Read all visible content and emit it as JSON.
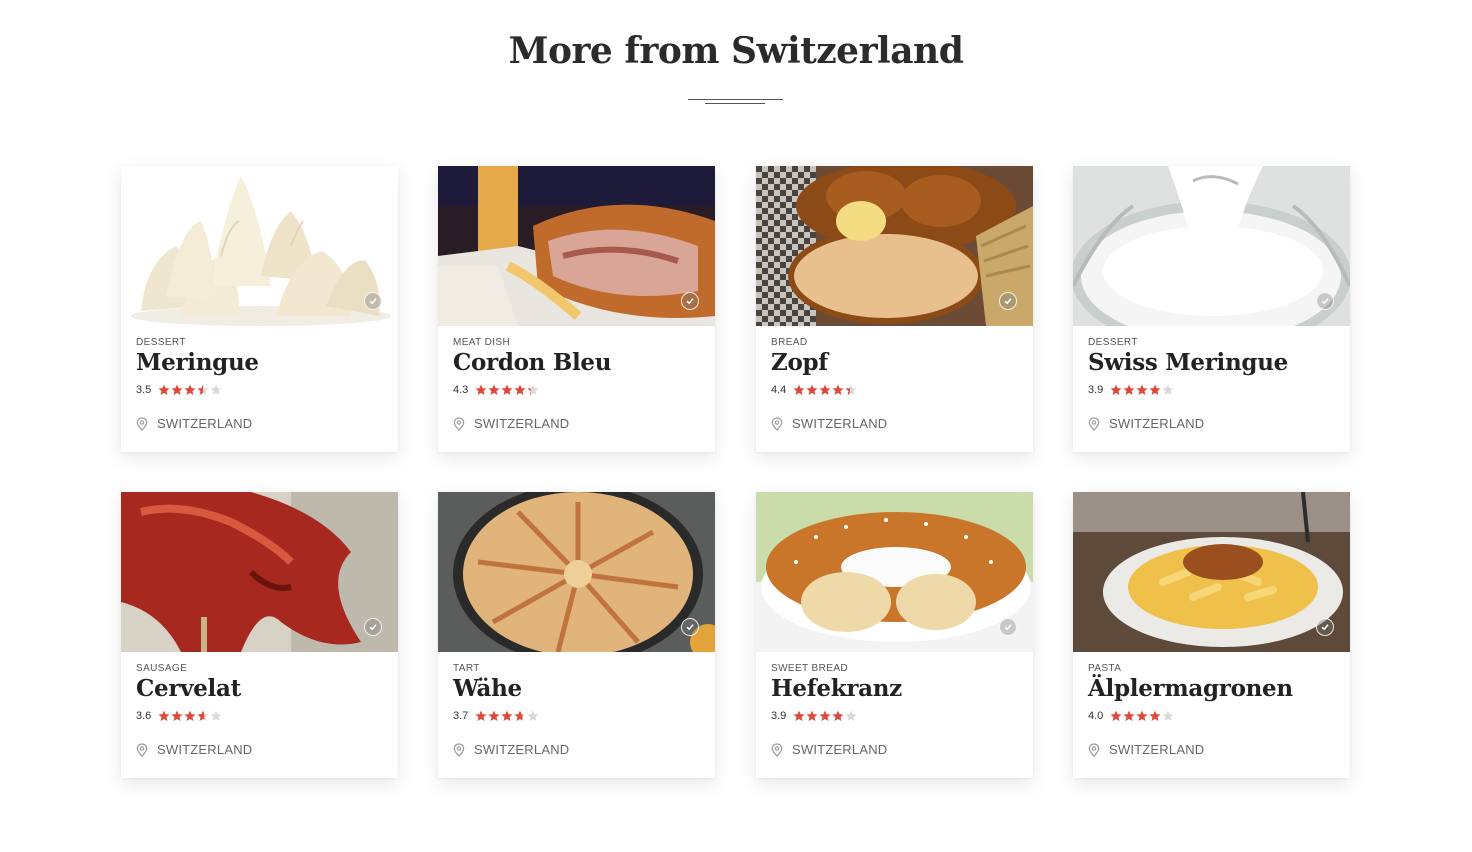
{
  "section": {
    "title": "More from Switzerland"
  },
  "colors": {
    "star_full": "#e0483a",
    "star_empty": "#d9d9d9"
  },
  "cards": [
    {
      "category": "DESSERT",
      "name": "Meringue",
      "rating": "3.5",
      "rating_value": 3.5,
      "location": "SWITZERLAND",
      "photo": "meringue"
    },
    {
      "category": "MEAT DISH",
      "name": "Cordon Bleu",
      "rating": "4.3",
      "rating_value": 4.3,
      "location": "SWITZERLAND",
      "photo": "cordon"
    },
    {
      "category": "BREAD",
      "name": "Zopf",
      "rating": "4.4",
      "rating_value": 4.4,
      "location": "SWITZERLAND",
      "photo": "zopf"
    },
    {
      "category": "DESSERT",
      "name": "Swiss Meringue",
      "rating": "3.9",
      "rating_value": 3.9,
      "location": "SWITZERLAND",
      "photo": "swissmeringue"
    },
    {
      "category": "SAUSAGE",
      "name": "Cervelat",
      "rating": "3.6",
      "rating_value": 3.6,
      "location": "SWITZERLAND",
      "photo": "cervelat"
    },
    {
      "category": "TART",
      "name": "Wähe",
      "rating": "3.7",
      "rating_value": 3.7,
      "location": "SWITZERLAND",
      "photo": "wahe"
    },
    {
      "category": "SWEET BREAD",
      "name": "Hefekranz",
      "rating": "3.9",
      "rating_value": 3.9,
      "location": "SWITZERLAND",
      "photo": "hefekranz"
    },
    {
      "category": "PASTA",
      "name": "Älplermagronen",
      "rating": "4.0",
      "rating_value": 4.0,
      "location": "SWITZERLAND",
      "photo": "alpler"
    }
  ]
}
